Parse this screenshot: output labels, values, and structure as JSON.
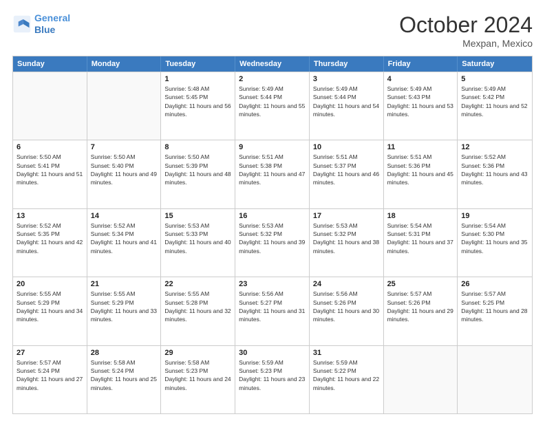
{
  "header": {
    "logo_line1": "General",
    "logo_line2": "Blue",
    "month": "October 2024",
    "location": "Mexpan, Mexico"
  },
  "weekdays": [
    "Sunday",
    "Monday",
    "Tuesday",
    "Wednesday",
    "Thursday",
    "Friday",
    "Saturday"
  ],
  "rows": [
    [
      {
        "day": "",
        "sunrise": "",
        "sunset": "",
        "daylight": ""
      },
      {
        "day": "",
        "sunrise": "",
        "sunset": "",
        "daylight": ""
      },
      {
        "day": "1",
        "sunrise": "Sunrise: 5:48 AM",
        "sunset": "Sunset: 5:45 PM",
        "daylight": "Daylight: 11 hours and 56 minutes."
      },
      {
        "day": "2",
        "sunrise": "Sunrise: 5:49 AM",
        "sunset": "Sunset: 5:44 PM",
        "daylight": "Daylight: 11 hours and 55 minutes."
      },
      {
        "day": "3",
        "sunrise": "Sunrise: 5:49 AM",
        "sunset": "Sunset: 5:44 PM",
        "daylight": "Daylight: 11 hours and 54 minutes."
      },
      {
        "day": "4",
        "sunrise": "Sunrise: 5:49 AM",
        "sunset": "Sunset: 5:43 PM",
        "daylight": "Daylight: 11 hours and 53 minutes."
      },
      {
        "day": "5",
        "sunrise": "Sunrise: 5:49 AM",
        "sunset": "Sunset: 5:42 PM",
        "daylight": "Daylight: 11 hours and 52 minutes."
      }
    ],
    [
      {
        "day": "6",
        "sunrise": "Sunrise: 5:50 AM",
        "sunset": "Sunset: 5:41 PM",
        "daylight": "Daylight: 11 hours and 51 minutes."
      },
      {
        "day": "7",
        "sunrise": "Sunrise: 5:50 AM",
        "sunset": "Sunset: 5:40 PM",
        "daylight": "Daylight: 11 hours and 49 minutes."
      },
      {
        "day": "8",
        "sunrise": "Sunrise: 5:50 AM",
        "sunset": "Sunset: 5:39 PM",
        "daylight": "Daylight: 11 hours and 48 minutes."
      },
      {
        "day": "9",
        "sunrise": "Sunrise: 5:51 AM",
        "sunset": "Sunset: 5:38 PM",
        "daylight": "Daylight: 11 hours and 47 minutes."
      },
      {
        "day": "10",
        "sunrise": "Sunrise: 5:51 AM",
        "sunset": "Sunset: 5:37 PM",
        "daylight": "Daylight: 11 hours and 46 minutes."
      },
      {
        "day": "11",
        "sunrise": "Sunrise: 5:51 AM",
        "sunset": "Sunset: 5:36 PM",
        "daylight": "Daylight: 11 hours and 45 minutes."
      },
      {
        "day": "12",
        "sunrise": "Sunrise: 5:52 AM",
        "sunset": "Sunset: 5:36 PM",
        "daylight": "Daylight: 11 hours and 43 minutes."
      }
    ],
    [
      {
        "day": "13",
        "sunrise": "Sunrise: 5:52 AM",
        "sunset": "Sunset: 5:35 PM",
        "daylight": "Daylight: 11 hours and 42 minutes."
      },
      {
        "day": "14",
        "sunrise": "Sunrise: 5:52 AM",
        "sunset": "Sunset: 5:34 PM",
        "daylight": "Daylight: 11 hours and 41 minutes."
      },
      {
        "day": "15",
        "sunrise": "Sunrise: 5:53 AM",
        "sunset": "Sunset: 5:33 PM",
        "daylight": "Daylight: 11 hours and 40 minutes."
      },
      {
        "day": "16",
        "sunrise": "Sunrise: 5:53 AM",
        "sunset": "Sunset: 5:32 PM",
        "daylight": "Daylight: 11 hours and 39 minutes."
      },
      {
        "day": "17",
        "sunrise": "Sunrise: 5:53 AM",
        "sunset": "Sunset: 5:32 PM",
        "daylight": "Daylight: 11 hours and 38 minutes."
      },
      {
        "day": "18",
        "sunrise": "Sunrise: 5:54 AM",
        "sunset": "Sunset: 5:31 PM",
        "daylight": "Daylight: 11 hours and 37 minutes."
      },
      {
        "day": "19",
        "sunrise": "Sunrise: 5:54 AM",
        "sunset": "Sunset: 5:30 PM",
        "daylight": "Daylight: 11 hours and 35 minutes."
      }
    ],
    [
      {
        "day": "20",
        "sunrise": "Sunrise: 5:55 AM",
        "sunset": "Sunset: 5:29 PM",
        "daylight": "Daylight: 11 hours and 34 minutes."
      },
      {
        "day": "21",
        "sunrise": "Sunrise: 5:55 AM",
        "sunset": "Sunset: 5:29 PM",
        "daylight": "Daylight: 11 hours and 33 minutes."
      },
      {
        "day": "22",
        "sunrise": "Sunrise: 5:55 AM",
        "sunset": "Sunset: 5:28 PM",
        "daylight": "Daylight: 11 hours and 32 minutes."
      },
      {
        "day": "23",
        "sunrise": "Sunrise: 5:56 AM",
        "sunset": "Sunset: 5:27 PM",
        "daylight": "Daylight: 11 hours and 31 minutes."
      },
      {
        "day": "24",
        "sunrise": "Sunrise: 5:56 AM",
        "sunset": "Sunset: 5:26 PM",
        "daylight": "Daylight: 11 hours and 30 minutes."
      },
      {
        "day": "25",
        "sunrise": "Sunrise: 5:57 AM",
        "sunset": "Sunset: 5:26 PM",
        "daylight": "Daylight: 11 hours and 29 minutes."
      },
      {
        "day": "26",
        "sunrise": "Sunrise: 5:57 AM",
        "sunset": "Sunset: 5:25 PM",
        "daylight": "Daylight: 11 hours and 28 minutes."
      }
    ],
    [
      {
        "day": "27",
        "sunrise": "Sunrise: 5:57 AM",
        "sunset": "Sunset: 5:24 PM",
        "daylight": "Daylight: 11 hours and 27 minutes."
      },
      {
        "day": "28",
        "sunrise": "Sunrise: 5:58 AM",
        "sunset": "Sunset: 5:24 PM",
        "daylight": "Daylight: 11 hours and 25 minutes."
      },
      {
        "day": "29",
        "sunrise": "Sunrise: 5:58 AM",
        "sunset": "Sunset: 5:23 PM",
        "daylight": "Daylight: 11 hours and 24 minutes."
      },
      {
        "day": "30",
        "sunrise": "Sunrise: 5:59 AM",
        "sunset": "Sunset: 5:23 PM",
        "daylight": "Daylight: 11 hours and 23 minutes."
      },
      {
        "day": "31",
        "sunrise": "Sunrise: 5:59 AM",
        "sunset": "Sunset: 5:22 PM",
        "daylight": "Daylight: 11 hours and 22 minutes."
      },
      {
        "day": "",
        "sunrise": "",
        "sunset": "",
        "daylight": ""
      },
      {
        "day": "",
        "sunrise": "",
        "sunset": "",
        "daylight": ""
      }
    ]
  ]
}
